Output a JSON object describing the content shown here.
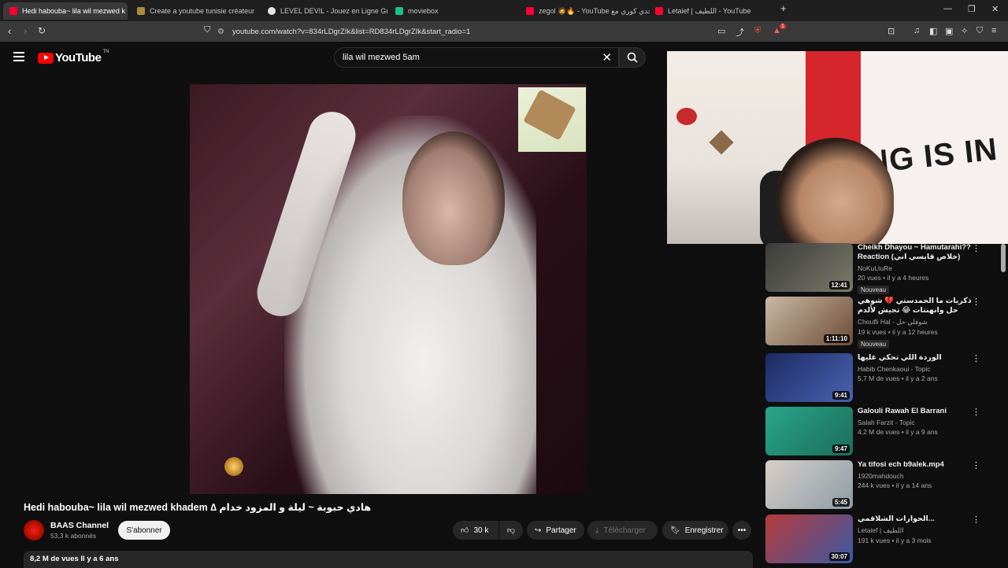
{
  "browser": {
    "tabs": [
      {
        "title": "Hedi habouba~ lila wil mezwed k",
        "fav_color": "#ff0033",
        "active": true
      },
      {
        "title": "Create a youtube tunisie créateur de",
        "fav_color": "#a68b3c",
        "active": false
      },
      {
        "title": "LEVEL DEVIL - Jouez en Ligne Gratuit",
        "fav_color": "#e6e6e6",
        "active": false
      },
      {
        "title": "moviebox",
        "fav_color": "#18c08a",
        "active": false
      },
      {
        "title": "zegol 🧔🔥 - YouTube تحدي كوري مع",
        "fav_color": "#ff0033",
        "active": false
      },
      {
        "title": "Letaief | اللطيف - YouTube",
        "fav_color": "#ff0033",
        "active": false
      }
    ],
    "new_tab": "+",
    "url": "youtube.com/watch?v=834rLDgrZIk&list=RD834rLDgrZIk&start_radio=1",
    "extension_badge": "1"
  },
  "header": {
    "logo_word": "YouTube",
    "logo_region": "TN",
    "search_value": "lila wil mezwed 5am"
  },
  "video": {
    "title": "Hedi habouba~ lila wil mezwed khadem ∆ هادي حبوبة ~ ليلة و المزود خدام",
    "channel": "BAAS Channel",
    "subscribers": "53,3 k abonnés",
    "subscribe": "S'abonner",
    "likes": "30 k",
    "share": "Partager",
    "download": "Télécharger",
    "save": "Enregistrer",
    "views_date": "8,2 M de vues  Il y a 6 ans"
  },
  "recommendations": [
    {
      "title": "Cheikh Dhayou ~ Hamutarahi?? Reaction (خلاص قايسي اني)",
      "channel": "NoKuLtuRe",
      "meta": "20 vues • il y a 4 heures",
      "duration": "12:41",
      "badge": "Nouveau",
      "thumb": [
        "#3b3b3b",
        "#7a7a6a"
      ]
    },
    {
      "title": "ذكريات ما الحمدستي 💔 شوهي حل وانهنتات 😂 تجيش لألدم",
      "channel": "Choufli Hal - شوفلي حل",
      "meta": "19 k vues • il y a 12 heures",
      "duration": "1:11:10",
      "badge": "Nouveau",
      "thumb": [
        "#c8b9a3",
        "#6e4d38"
      ]
    },
    {
      "title": "الوردة اللي تحكي عليها",
      "channel": "Habib Chenkaoui - Topic",
      "meta": "5,7 M de vues • il y a 2 ans",
      "duration": "9:41",
      "badge": "",
      "thumb": [
        "#1b2a63",
        "#4b63b0"
      ]
    },
    {
      "title": "Galouli Rawah El Barrani",
      "channel": "Salah Farzit - Topic",
      "meta": "4,2 M de vues • il y a 9 ans",
      "duration": "9:47",
      "badge": "",
      "thumb": [
        "#2aa58a",
        "#1c6d5a"
      ]
    },
    {
      "title": "Ya tifosi ech b9alek.mp4",
      "channel": "1920mahdouch",
      "meta": "244 k vues • il y a 14 ans",
      "duration": "5:45",
      "badge": "",
      "thumb": [
        "#d6cfc9",
        "#8e9ca6"
      ]
    },
    {
      "title": "الحوارات الشلاقمي...",
      "channel": "Letaief | اللطيف",
      "meta": "191 k vues • il y a 3 mois",
      "duration": "30:07",
      "badge": "",
      "thumb": [
        "#b63a3a",
        "#3a5aa6"
      ]
    }
  ],
  "colors": {
    "background": "#0f0f0f",
    "accent": "#ff0000",
    "pill": "#272727"
  }
}
